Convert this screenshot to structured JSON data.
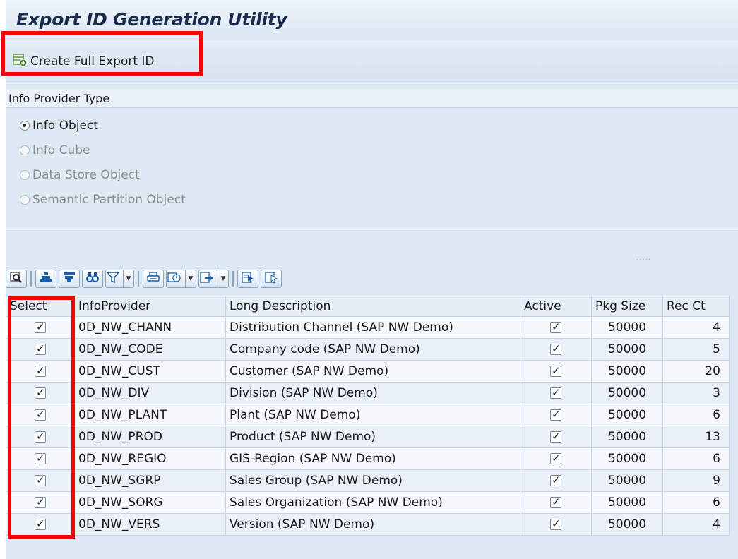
{
  "app": {
    "title": "Export ID Generation Utility"
  },
  "toolbar": {
    "create_label": "Create Full Export ID"
  },
  "provider_type": {
    "header": "Info Provider Type",
    "options": [
      {
        "label": "Info Object",
        "selected": true,
        "enabled": true
      },
      {
        "label": "Info Cube",
        "selected": false,
        "enabled": false
      },
      {
        "label": "Data Store Object",
        "selected": false,
        "enabled": false
      },
      {
        "label": "Semantic Partition Object",
        "selected": false,
        "enabled": false
      }
    ]
  },
  "grip": ".....",
  "alv_toolbar": {
    "buttons": [
      "details-icon",
      "sort-ascending-icon",
      "sort-descending-icon",
      "find-icon",
      "filter-icon",
      "print-icon",
      "views-icon",
      "export-icon",
      "select-all-icon",
      "deselect-all-icon"
    ]
  },
  "table": {
    "headers": {
      "select": "Select",
      "provider": "InfoProvider",
      "description": "Long Description",
      "active": "Active",
      "pkg_size": "Pkg Size",
      "rec_ct": "Rec Ct"
    },
    "rows": [
      {
        "provider": "0D_NW_CHANN",
        "description": "Distribution Channel (SAP NW Demo)",
        "pkg_size": "50000",
        "rec_ct": "4",
        "selected": true,
        "active": true
      },
      {
        "provider": "0D_NW_CODE",
        "description": "Company code (SAP NW Demo)",
        "pkg_size": "50000",
        "rec_ct": "5",
        "selected": true,
        "active": true
      },
      {
        "provider": "0D_NW_CUST",
        "description": "Customer (SAP NW Demo)",
        "pkg_size": "50000",
        "rec_ct": "20",
        "selected": true,
        "active": true
      },
      {
        "provider": "0D_NW_DIV",
        "description": "Division (SAP NW Demo)",
        "pkg_size": "50000",
        "rec_ct": "3",
        "selected": true,
        "active": true
      },
      {
        "provider": "0D_NW_PLANT",
        "description": "Plant (SAP NW Demo)",
        "pkg_size": "50000",
        "rec_ct": "6",
        "selected": true,
        "active": true
      },
      {
        "provider": "0D_NW_PROD",
        "description": "Product (SAP NW Demo)",
        "pkg_size": "50000",
        "rec_ct": "13",
        "selected": true,
        "active": true
      },
      {
        "provider": "0D_NW_REGIO",
        "description": "GIS-Region (SAP NW Demo)",
        "pkg_size": "50000",
        "rec_ct": "6",
        "selected": true,
        "active": true
      },
      {
        "provider": "0D_NW_SGRP",
        "description": "Sales Group (SAP NW Demo)",
        "pkg_size": "50000",
        "rec_ct": "9",
        "selected": true,
        "active": true
      },
      {
        "provider": "0D_NW_SORG",
        "description": "Sales Organization (SAP NW Demo)",
        "pkg_size": "50000",
        "rec_ct": "6",
        "selected": true,
        "active": true
      },
      {
        "provider": "0D_NW_VERS",
        "description": "Version (SAP NW Demo)",
        "pkg_size": "50000",
        "rec_ct": "4",
        "selected": true,
        "active": true
      }
    ]
  },
  "colors": {
    "highlight": "#ff0000",
    "background": "#dfe9f3",
    "title": "#1b2b4d"
  }
}
